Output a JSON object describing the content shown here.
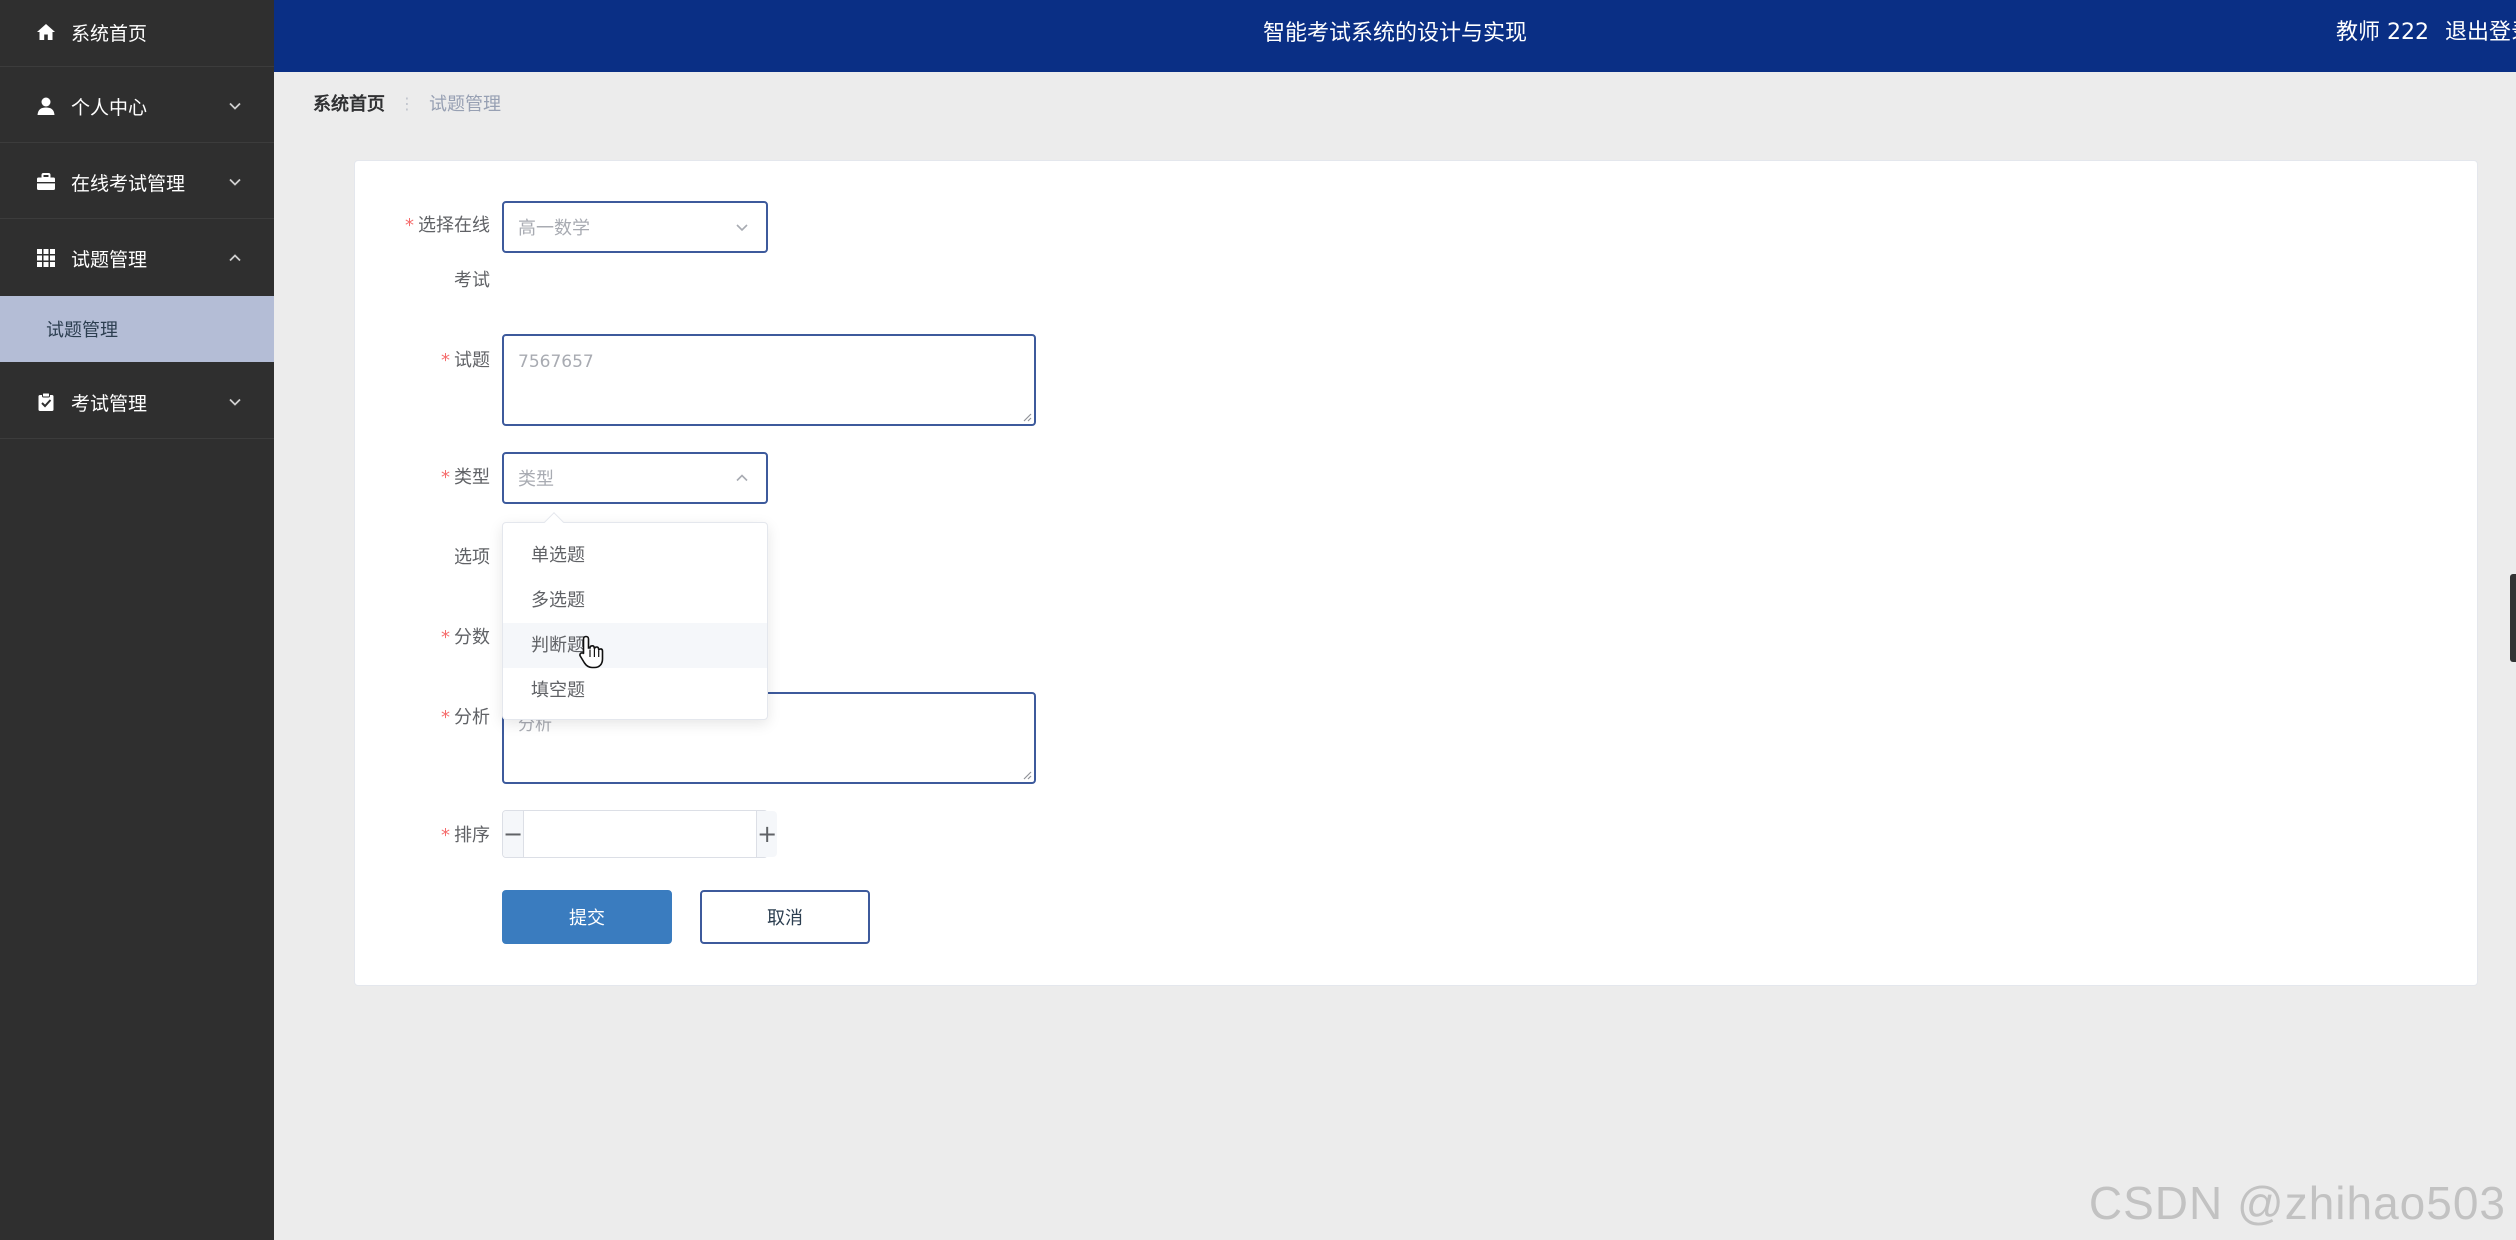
{
  "app": {
    "title": "智能考试系统的设计与实现",
    "user_label": "教师 222",
    "logout_label": "退出登录"
  },
  "sidebar": {
    "items": [
      {
        "label": "系统首页",
        "icon": "home-icon"
      },
      {
        "label": "个人中心",
        "icon": "user-icon",
        "expandable": true,
        "expanded": false
      },
      {
        "label": "在线考试管理",
        "icon": "briefcase-icon",
        "expandable": true,
        "expanded": false
      },
      {
        "label": "试题管理",
        "icon": "grid-icon",
        "expandable": true,
        "expanded": true
      },
      {
        "label": "考试管理",
        "icon": "clipboard-icon",
        "expandable": true,
        "expanded": false
      }
    ],
    "submenu": {
      "label": "试题管理",
      "active": true
    }
  },
  "breadcrumb": {
    "home": "系统首页",
    "separator": "⋮",
    "current": "试题管理"
  },
  "form": {
    "exam": {
      "label_line1": "选择在线",
      "label_line2": "考试",
      "value": "高一数学"
    },
    "question": {
      "label": "试题",
      "value": "7567657"
    },
    "type": {
      "label": "类型",
      "placeholder": "类型"
    },
    "options": {
      "label": "选项"
    },
    "score": {
      "label": "分数"
    },
    "analysis": {
      "label": "分析",
      "placeholder": "分析"
    },
    "sort": {
      "label": "排序",
      "minus": "−",
      "plus": "+"
    },
    "submit_label": "提交",
    "cancel_label": "取消"
  },
  "type_dropdown": {
    "options": [
      "单选题",
      "多选题",
      "判断题",
      "填空题"
    ],
    "hovered_index": 2
  },
  "watermark": "CSDN @zhihao503",
  "colors": {
    "sidebar_bg": "#2f2f2f",
    "header_bg": "#0a2f85",
    "submenu_active_bg": "#b4bdd6",
    "primary_button": "#3a7cbf",
    "required_asterisk": "#f56c6c"
  }
}
